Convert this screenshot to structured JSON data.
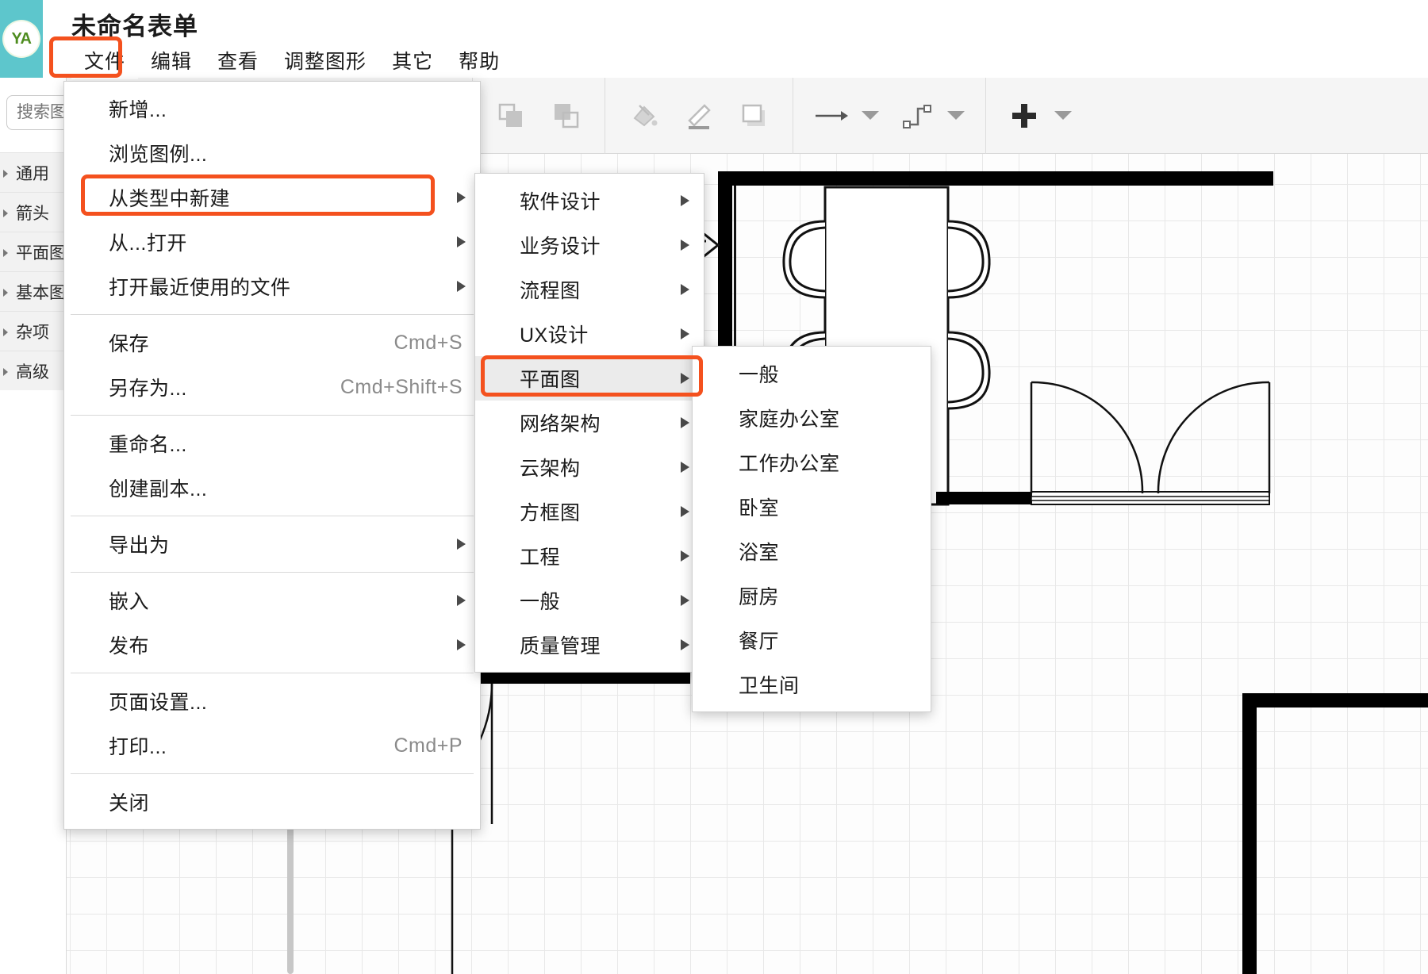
{
  "app": {
    "avatar_initials": "YA",
    "document_title": "未命名表单",
    "accent_highlight": "#f4511e",
    "avatar_bg": "#5dc6cc",
    "avatar_text_color": "#4e8c1f"
  },
  "menubar": {
    "items": [
      {
        "label": "文件",
        "highlighted": true
      },
      {
        "label": "编辑",
        "highlighted": false
      },
      {
        "label": "查看",
        "highlighted": false
      },
      {
        "label": "调整图形",
        "highlighted": false
      },
      {
        "label": "其它",
        "highlighted": false
      },
      {
        "label": "帮助",
        "highlighted": false
      }
    ]
  },
  "sidebar": {
    "search_placeholder": "搜索图形",
    "categories": [
      {
        "label": "通用"
      },
      {
        "label": "箭头"
      },
      {
        "label": "平面图"
      },
      {
        "label": "基本图形"
      },
      {
        "label": "杂项"
      },
      {
        "label": "高级"
      }
    ]
  },
  "toolbar": {
    "groups": [
      {
        "buttons": [
          {
            "icon": "bring-to-front-icon"
          },
          {
            "icon": "send-to-back-icon"
          }
        ]
      },
      {
        "buttons": [
          {
            "icon": "fill-color-icon"
          },
          {
            "icon": "line-color-icon"
          },
          {
            "icon": "shadow-icon"
          }
        ]
      },
      {
        "buttons": [
          {
            "icon": "arrow-style-icon",
            "has_dropdown": true
          },
          {
            "icon": "waypoint-style-icon",
            "has_dropdown": true
          }
        ]
      },
      {
        "buttons": [
          {
            "icon": "insert-plus-icon",
            "has_dropdown": true
          }
        ]
      }
    ]
  },
  "file_menu": {
    "sections": [
      {
        "items": [
          {
            "label": "新增...",
            "shortcut": "",
            "submenu": false
          },
          {
            "label": "浏览图例...",
            "shortcut": "",
            "submenu": false
          },
          {
            "label": "从类型中新建",
            "shortcut": "",
            "submenu": true,
            "highlighted": true
          },
          {
            "label": "从...打开",
            "shortcut": "",
            "submenu": true
          },
          {
            "label": "打开最近使用的文件",
            "shortcut": "",
            "submenu": true
          }
        ]
      },
      {
        "items": [
          {
            "label": "保存",
            "shortcut": "Cmd+S",
            "submenu": false
          },
          {
            "label": "另存为...",
            "shortcut": "Cmd+Shift+S",
            "submenu": false
          }
        ]
      },
      {
        "items": [
          {
            "label": "重命名...",
            "shortcut": "",
            "submenu": false
          },
          {
            "label": "创建副本...",
            "shortcut": "",
            "submenu": false
          }
        ]
      },
      {
        "items": [
          {
            "label": "导出为",
            "shortcut": "",
            "submenu": true
          }
        ]
      },
      {
        "items": [
          {
            "label": "嵌入",
            "shortcut": "",
            "submenu": true
          },
          {
            "label": "发布",
            "shortcut": "",
            "submenu": true
          }
        ]
      },
      {
        "items": [
          {
            "label": "页面设置...",
            "shortcut": "",
            "submenu": false
          },
          {
            "label": "打印...",
            "shortcut": "Cmd+P",
            "submenu": false
          }
        ]
      },
      {
        "items": [
          {
            "label": "关闭",
            "shortcut": "",
            "submenu": false
          }
        ]
      }
    ]
  },
  "type_menu": {
    "items": [
      {
        "label": "软件设计",
        "submenu": true
      },
      {
        "label": "业务设计",
        "submenu": true
      },
      {
        "label": "流程图",
        "submenu": true
      },
      {
        "label": "UX设计",
        "submenu": true
      },
      {
        "label": "平面图",
        "submenu": true,
        "highlighted": true,
        "selected": true
      },
      {
        "label": "网络架构",
        "submenu": true
      },
      {
        "label": "云架构",
        "submenu": true
      },
      {
        "label": "方框图",
        "submenu": true
      },
      {
        "label": "工程",
        "submenu": true
      },
      {
        "label": "一般",
        "submenu": true
      },
      {
        "label": "质量管理",
        "submenu": true
      }
    ]
  },
  "floorplan_menu": {
    "items": [
      {
        "label": "一般"
      },
      {
        "label": "家庭办公室"
      },
      {
        "label": "工作办公室"
      },
      {
        "label": "卧室"
      },
      {
        "label": "浴室"
      },
      {
        "label": "厨房"
      },
      {
        "label": "餐厅"
      },
      {
        "label": "卫生间"
      }
    ]
  }
}
